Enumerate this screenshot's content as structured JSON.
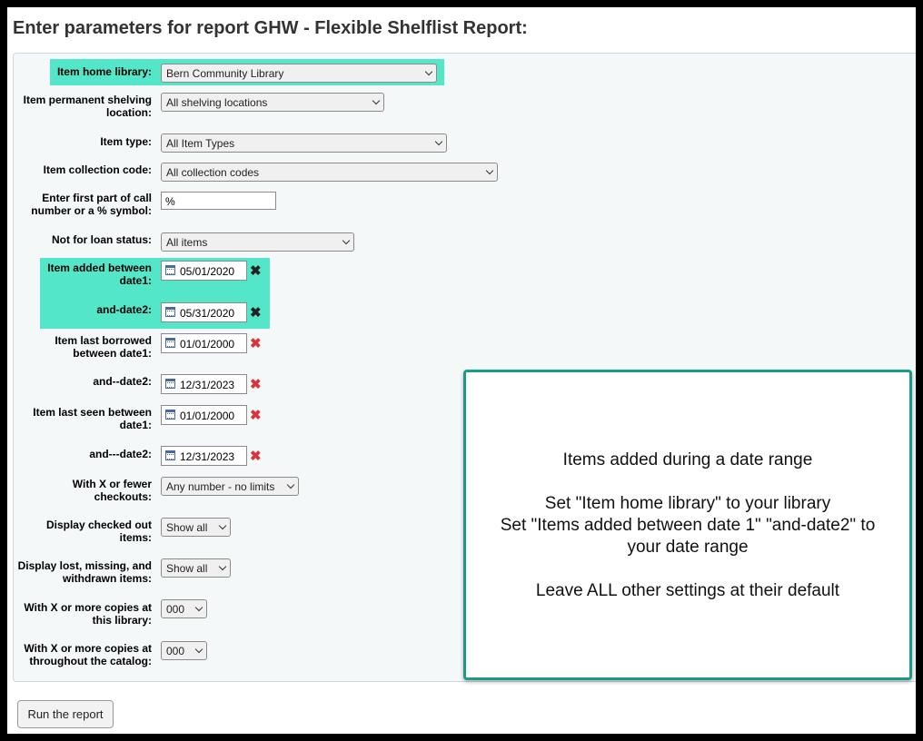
{
  "title": "Enter parameters for report GHW - Flexible Shelflist Report:",
  "fields": {
    "home_library": {
      "label": "Item home library:",
      "value": "Bern Community Library"
    },
    "shelving": {
      "label": "Item permanent shelving location:",
      "value": "All shelving locations"
    },
    "item_type": {
      "label": "Item type:",
      "value": "All Item Types"
    },
    "collection": {
      "label": "Item collection code:",
      "value": "All collection codes"
    },
    "call_number": {
      "label": "Enter first part of call number or a % symbol:",
      "value": "%"
    },
    "not_for_loan": {
      "label": "Not for loan status:",
      "value": "All items"
    },
    "added_date1": {
      "label": "Item added between date1:",
      "value": "05/01/2020"
    },
    "added_date2": {
      "label": "and-date2:",
      "value": "05/31/2020"
    },
    "borrowed_date1": {
      "label": "Item last borrowed between date1:",
      "value": "01/01/2000"
    },
    "borrowed_date2": {
      "label": "and--date2:",
      "value": "12/31/2023"
    },
    "seen_date1": {
      "label": "Item last seen between date1:",
      "value": "01/01/2000"
    },
    "seen_date2": {
      "label": "and---date2:",
      "value": "12/31/2023"
    },
    "checkouts": {
      "label": "With X or fewer checkouts:",
      "value": "Any number - no limits"
    },
    "checked_out": {
      "label": "Display checked out items:",
      "value": "Show all"
    },
    "lost_missing": {
      "label": "Display lost, missing, and withdrawn items:",
      "value": "Show all"
    },
    "copies_library": {
      "label": "With X or more copies at this library:",
      "value": "000"
    },
    "copies_catalog": {
      "label": "With X or more copies at throughout the catalog:",
      "value": "000"
    }
  },
  "clear_icon": "x-mark",
  "note": {
    "line1": "Items added during a date range",
    "line2": "Set \"Item home library\" to your library",
    "line3": "Set \"Items added between date 1\" \"and-date2\" to",
    "line4": "your date range",
    "line5": "Leave ALL other settings at their default"
  },
  "run_button": "Run the report",
  "colors": {
    "highlight": "#53e6c8",
    "note_border": "#1a9b86",
    "clear_red": "#d9343b"
  }
}
